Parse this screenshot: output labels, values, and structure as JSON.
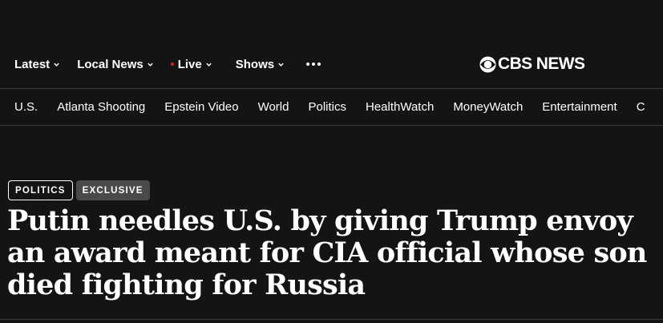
{
  "header": {
    "nav": [
      {
        "label": "Latest",
        "has_chevron": true
      },
      {
        "label": "Local News",
        "has_chevron": true
      },
      {
        "label": "Live",
        "has_chevron": true,
        "live_indicator_color": "#e02020"
      },
      {
        "label": "Shows",
        "has_chevron": true
      }
    ],
    "more_icon": "ellipsis-icon",
    "logo_text": "CBS NEWS",
    "logo_icon": "cbs-eye-icon"
  },
  "subnav": {
    "items": [
      "U.S.",
      "Atlanta Shooting",
      "Epstein Video",
      "World",
      "Politics",
      "HealthWatch",
      "MoneyWatch",
      "Entertainment",
      "C"
    ]
  },
  "article": {
    "tags": [
      "POLITICS",
      "EXCLUSIVE"
    ],
    "headline": "Putin needles U.S. by giving Trump envoy an award meant for CIA official whose son died fighting for Russia"
  },
  "colors": {
    "background": "#141414",
    "text": "#ffffff",
    "divider": "#3a3a3a",
    "exclusive_tag_bg": "#4a4a4a",
    "live_dot": "#e02020"
  }
}
